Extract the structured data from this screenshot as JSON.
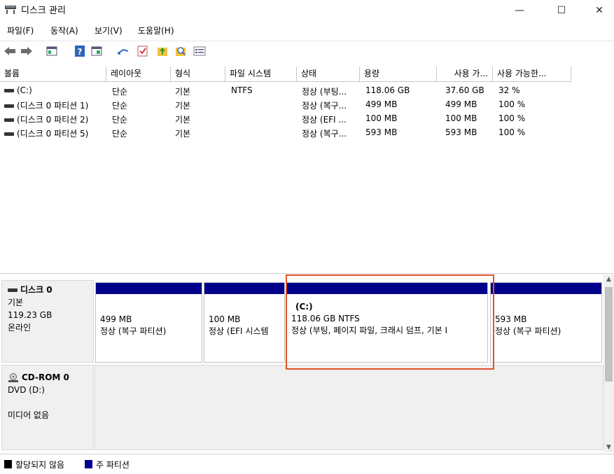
{
  "window": {
    "title": "디스크 관리",
    "minimize": "—",
    "maximize": "☐",
    "close": "✕"
  },
  "menu": [
    "파일(F)",
    "동작(A)",
    "보기(V)",
    "도움말(H)"
  ],
  "toolbar_icons": [
    "back-icon",
    "forward-icon",
    "volume-list-icon",
    "help-icon",
    "disk-view-icon",
    "connect-icon",
    "check-icon",
    "up-arrow-icon",
    "search-icon",
    "properties-icon"
  ],
  "columns": [
    "볼륨",
    "레이아웃",
    "형식",
    "파일 시스템",
    "상태",
    "용량",
    "사용 가...",
    "사용 가능한..."
  ],
  "volumes": [
    {
      "name": "(C:)",
      "layout": "단순",
      "type": "기본",
      "fs": "NTFS",
      "status": "정상 (부팅...",
      "capacity": "118.06 GB",
      "free": "37.60 GB",
      "pct": "32 %"
    },
    {
      "name": "(디스크 0 파티션 1)",
      "layout": "단순",
      "type": "기본",
      "fs": "",
      "status": "정상 (복구...",
      "capacity": "499 MB",
      "free": "499 MB",
      "pct": "100 %"
    },
    {
      "name": "(디스크 0 파티션 2)",
      "layout": "단순",
      "type": "기본",
      "fs": "",
      "status": "정상 (EFI ...",
      "capacity": "100 MB",
      "free": "100 MB",
      "pct": "100 %"
    },
    {
      "name": "(디스크 0 파티션 5)",
      "layout": "단순",
      "type": "기본",
      "fs": "",
      "status": "정상 (복구...",
      "capacity": "593 MB",
      "free": "593 MB",
      "pct": "100 %"
    }
  ],
  "disk0": {
    "name": "디스크 0",
    "kind": "기본",
    "size": "119.23 GB",
    "state": "온라인",
    "partitions": [
      {
        "line1": "",
        "line2": "499 MB",
        "line3": "정상 (복구 파티션)"
      },
      {
        "line1": "",
        "line2": "100 MB",
        "line3": "정상 (EFI 시스템"
      },
      {
        "line1": "(C:)",
        "line2": "118.06 GB NTFS",
        "line3": "정상 (부팅, 페이지 파일, 크래시 덤프, 기본 I"
      },
      {
        "line1": "",
        "line2": "593 MB",
        "line3": "정상 (복구 파티션)"
      }
    ]
  },
  "cdrom": {
    "name": "CD-ROM 0",
    "drive": "DVD (D:)",
    "media": "미디어 없음"
  },
  "legend": {
    "unallocated": "할당되지 않음",
    "primary": "주 파티션",
    "unallocated_color": "#000000",
    "primary_color": "#00008b"
  }
}
